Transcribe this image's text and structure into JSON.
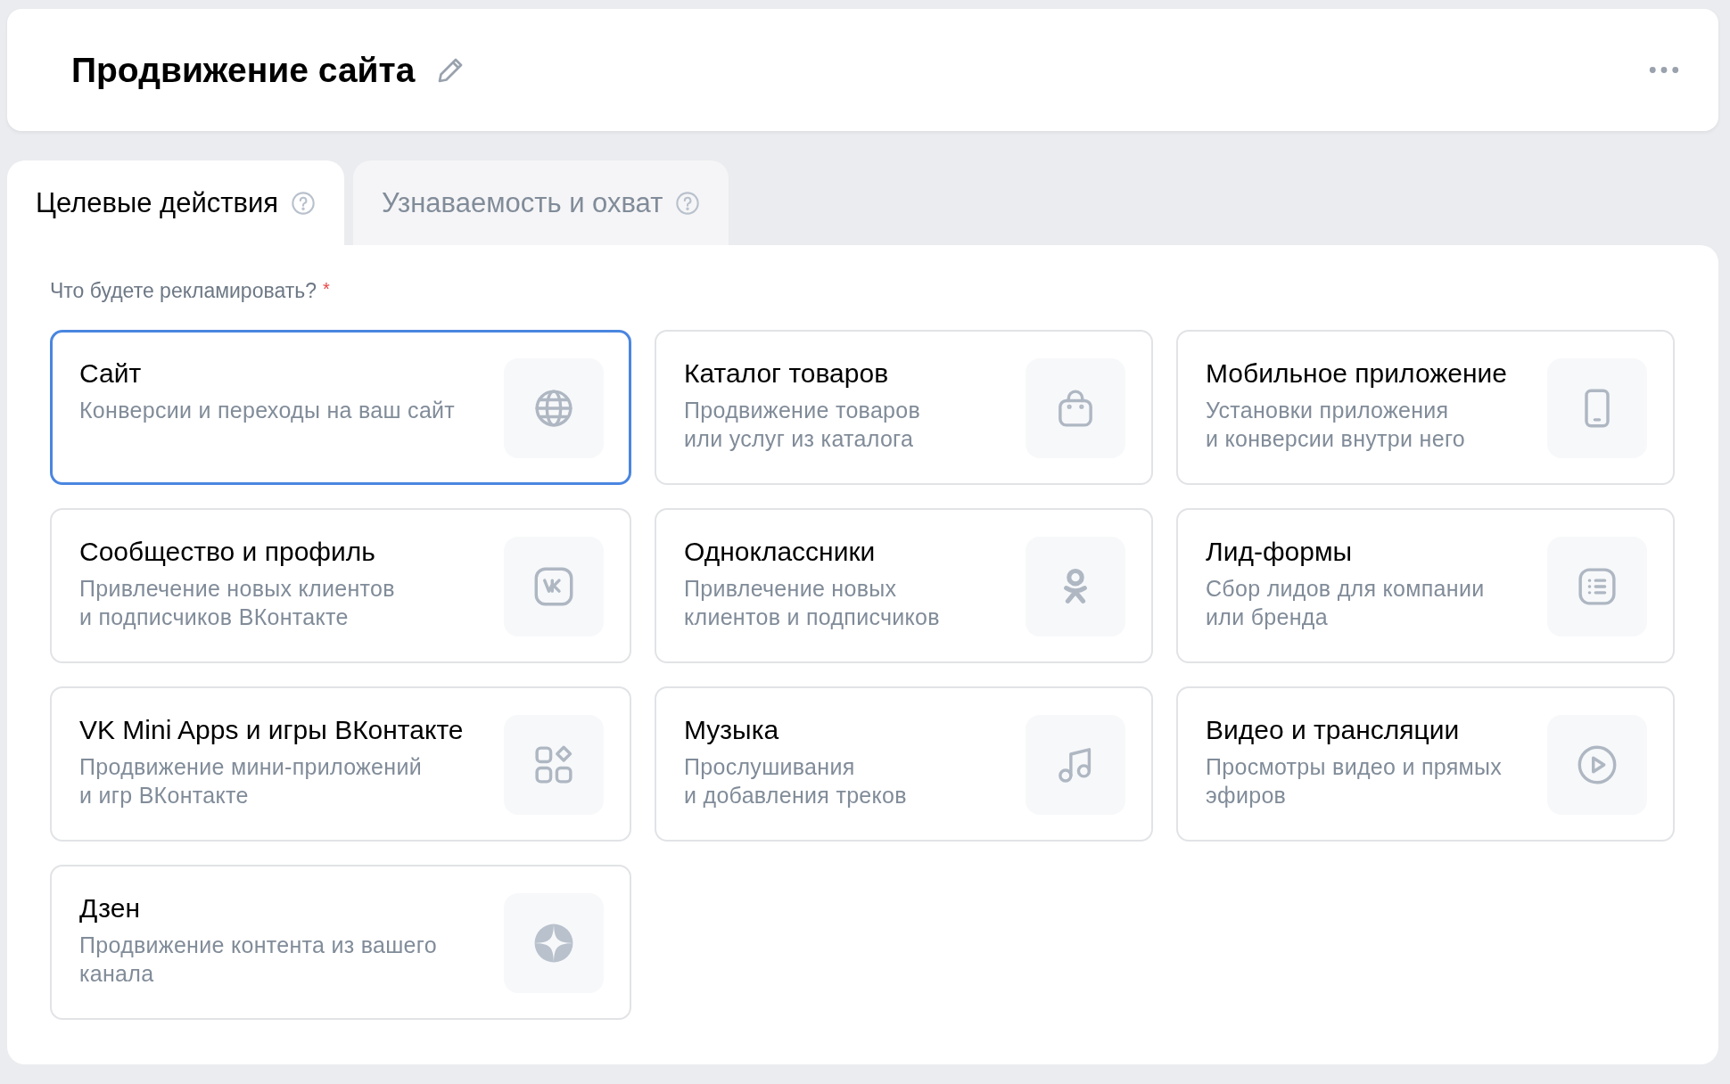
{
  "header": {
    "title": "Продвижение сайта"
  },
  "tabs": [
    {
      "label": "Целевые действия",
      "selected": true
    },
    {
      "label": "Узнаваемость и охват",
      "selected": false
    }
  ],
  "question": {
    "label": "Что будете рекламировать?",
    "required_mark": "*"
  },
  "options": [
    {
      "title": "Сайт",
      "description": "Конверсии и переходы на ваш сайт",
      "kind": "globe",
      "selected": true
    },
    {
      "title": "Каталог товаров",
      "description": "Продвижение товаров\nили услуг из каталога",
      "kind": "bag",
      "selected": false
    },
    {
      "title": "Мобильное приложение",
      "description": "Установки приложения\nи конверсии внутри него",
      "kind": "phone",
      "selected": false
    },
    {
      "title": "Сообщество и профиль",
      "description": "Привлечение новых клиентов\nи подписчиков ВКонтакте",
      "kind": "vk",
      "selected": false
    },
    {
      "title": "Одноклассники",
      "description": "Привлечение новых\nклиентов и подписчиков",
      "kind": "ok",
      "selected": false
    },
    {
      "title": "Лид-формы",
      "description": "Сбор лидов для компании\nили бренда",
      "kind": "list",
      "selected": false
    },
    {
      "title": "VK Mini Apps и игры ВКонтакте",
      "description": "Продвижение мини-приложений\nи игр ВКонтакте",
      "kind": "apps",
      "selected": false
    },
    {
      "title": "Музыка",
      "description": "Прослушивания\nи добавления треков",
      "kind": "music",
      "selected": false
    },
    {
      "title": "Видео и трансляции",
      "description": "Просмотры видео и прямых\nэфиров",
      "kind": "play",
      "selected": false
    },
    {
      "title": "Дзен",
      "description": "Продвижение контента из вашего\nканала",
      "kind": "zen",
      "selected": false
    }
  ]
}
